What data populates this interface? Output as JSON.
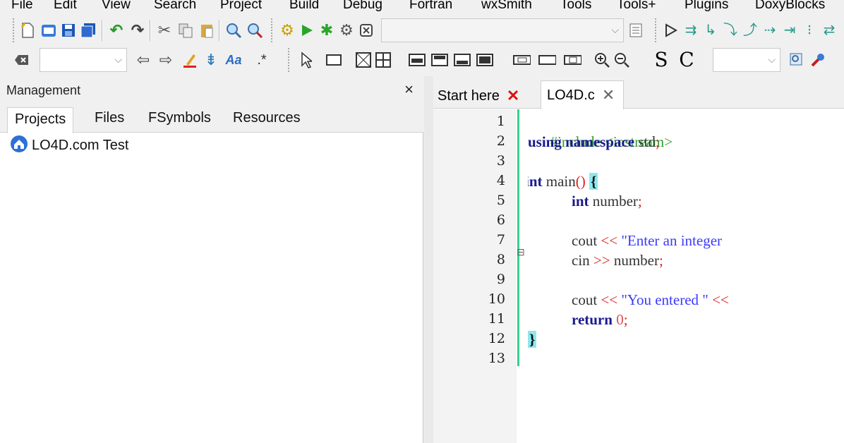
{
  "menu": [
    "File",
    "Edit",
    "View",
    "Search",
    "Project",
    "Build",
    "Debug",
    "Fortran",
    "wxSmith",
    "Tools",
    "Tools+",
    "Plugins",
    "DoxyBlocks"
  ],
  "toolbar2": {
    "font_s": "S",
    "font_c": "C"
  },
  "management": {
    "title": "Management",
    "close": "×",
    "tabs": [
      "Projects",
      "Files",
      "FSymbols",
      "Resources"
    ],
    "active_tab": "Projects",
    "project": "LO4D.com Test"
  },
  "editor": {
    "tabs": [
      {
        "label": "Start here",
        "close": "✕"
      },
      {
        "label": "LO4D.c",
        "close": "✕"
      }
    ],
    "active_tab": "LO4D.c",
    "line_numbers": [
      "1",
      "2",
      "3",
      "4",
      "5",
      "6",
      "7",
      "8",
      "9",
      "10",
      "11",
      "12",
      "13"
    ],
    "code": {
      "l1_a": "#include <iostream>",
      "l2_kw1": "using",
      "l2_kw2": "namespace",
      "l2_id": "std",
      "l2_semi": ";",
      "l4_kw": "int",
      "l4_id": "main",
      "l4_paren": "()",
      "l4_brace": "{",
      "l5_kw": "int",
      "l5_id": "number",
      "l5_semi": ";",
      "l7_id": "cout",
      "l7_op": "<<",
      "l7_str": "\"Enter an integer",
      "l8_id": "cin",
      "l8_op": ">>",
      "l8_id2": "number",
      "l8_semi": ";",
      "l10_id": "cout",
      "l10_op": "<<",
      "l10_str": "\"You entered \"",
      "l10_op2": "<<",
      "l11_kw": "return",
      "l11_num": "0",
      "l11_semi": ";",
      "l12_brace": "}"
    }
  },
  "colors": {
    "accent_green": "#35d08a",
    "keyword": "#1a1a8c",
    "string": "#3a3aff",
    "operator": "#e02020",
    "preprocessor": "#2f9d2f",
    "brace_highlight": "#8ee8ee"
  }
}
